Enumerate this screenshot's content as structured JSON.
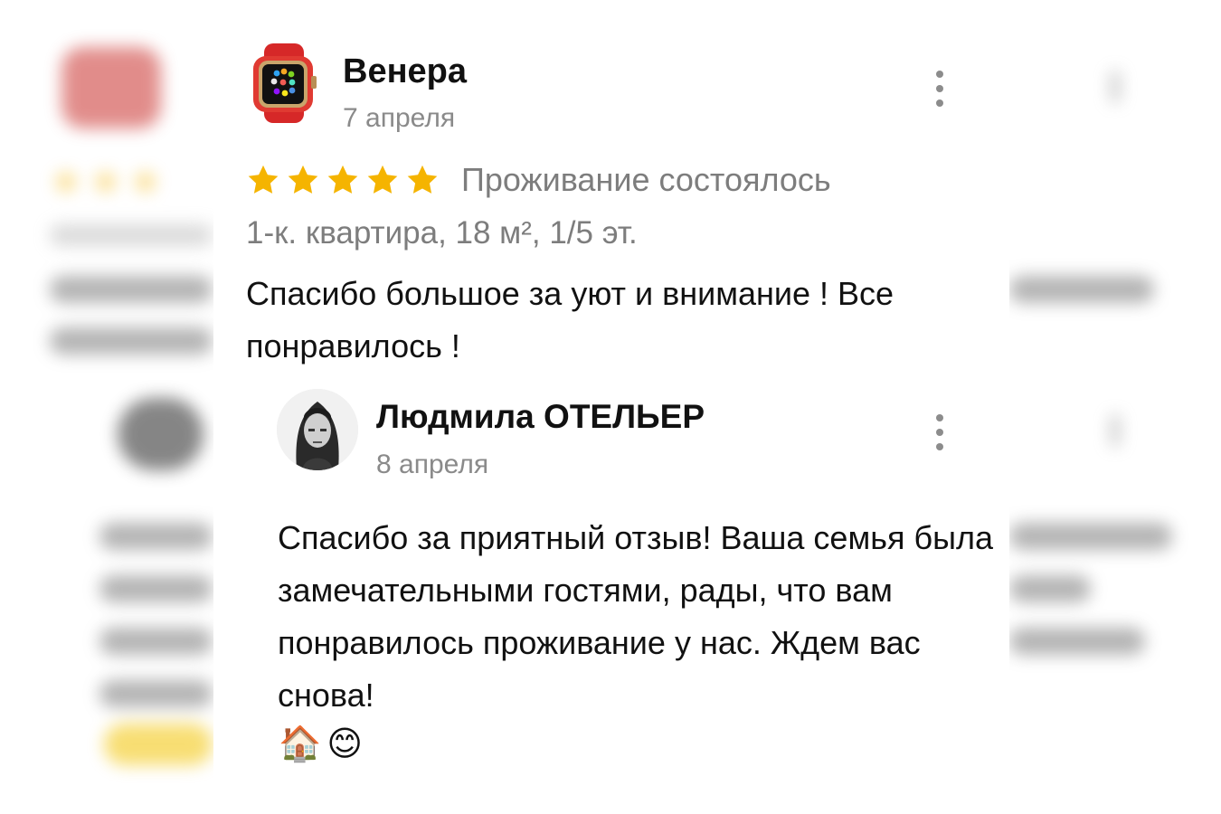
{
  "review": {
    "author_name": "Венера",
    "date": "7 апреля",
    "rating": 5,
    "rating_max": 5,
    "status": "Проживание состоялось",
    "listing": "1-к. квартира, 18 м², 1/5 эт.",
    "text": "Спасибо большое за уют и внимание ! Все понравилось !",
    "avatar_icon": "smartwatch-icon",
    "star_color": "#f5b400"
  },
  "reply": {
    "author_name": "Людмила ОТЕЛЬЕР",
    "date": "8 апреля",
    "text": "Спасибо за приятный отзыв! Ваша семья была замечательными гостями, рады, что вам понравилось проживание у нас. Ждем вас снова!",
    "emojis": [
      "🏠",
      "😊"
    ],
    "avatar_icon": "user-photo"
  },
  "icons": {
    "menu": "more-vertical-icon",
    "star": "star-icon"
  }
}
